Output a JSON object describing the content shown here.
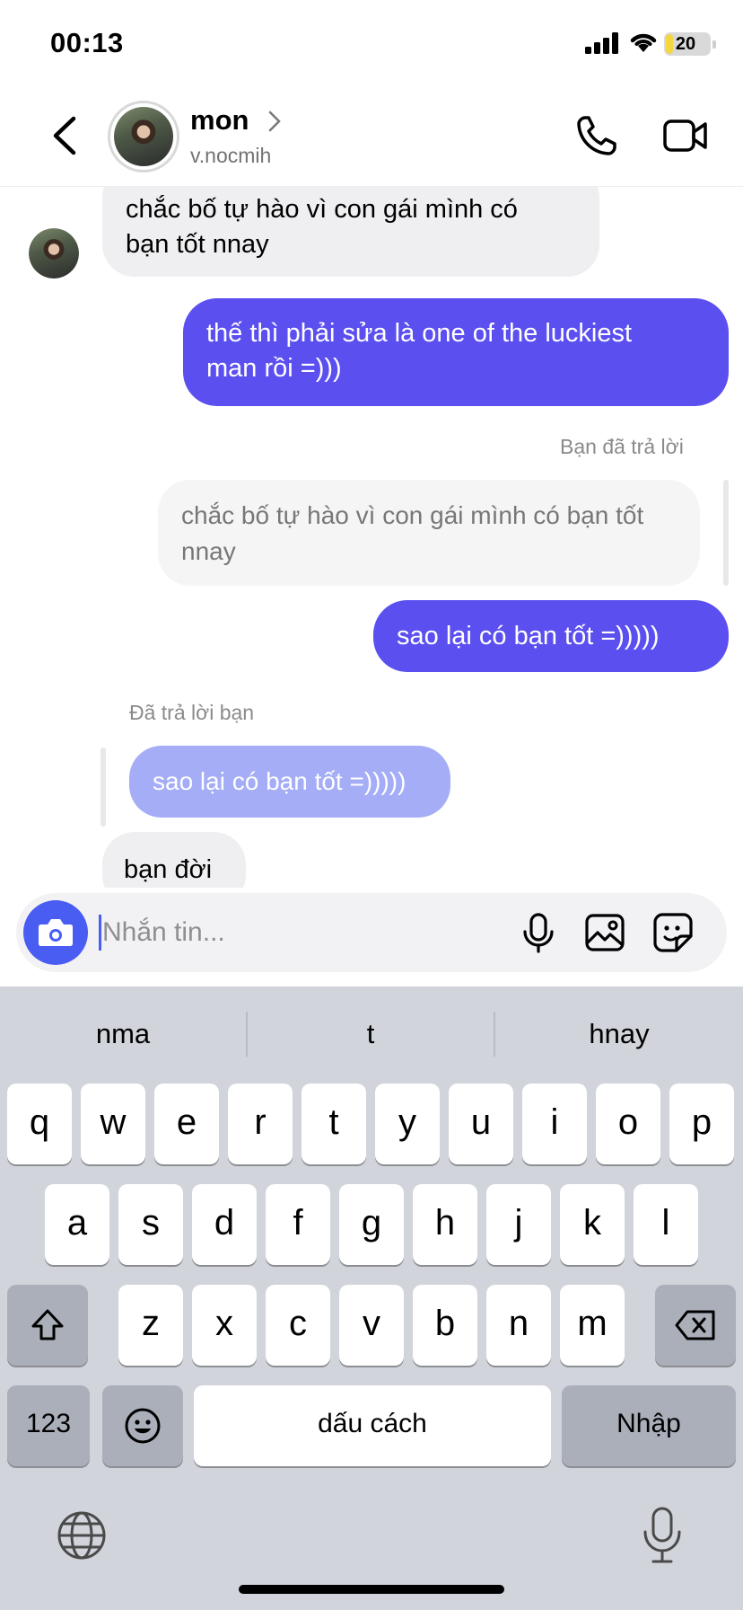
{
  "status_bar": {
    "time": "00:13",
    "battery": "20",
    "battery_level": 0.2
  },
  "header": {
    "contact_name": "mon",
    "username": "v.nocmih",
    "icons": [
      "back-arrow-icon",
      "chevron-right-icon",
      "phone-icon",
      "video-camera-icon"
    ]
  },
  "messages": {
    "msg1": {
      "lines": [
        "chắc bố tự hào vì con gái mình có",
        "bạn tốt nnay"
      ]
    },
    "msg2": {
      "lines": [
        "thế thì phải sửa là one of the luckiest",
        "man rồi =)))"
      ]
    },
    "reply1_label": "Bạn đã trả lời",
    "reply1_quote": {
      "lines": [
        "chắc bố tự hào vì con gái mình có bạn tốt",
        "nnay"
      ]
    },
    "msg3": "sao lại có bạn tốt =)))))",
    "reply2_label": "Đã trả lời bạn",
    "reply2_quote": "sao lại có bạn tốt =)))))",
    "msg4": "bạn đời"
  },
  "composer": {
    "placeholder": "Nhắn tin...",
    "value": ""
  },
  "keyboard": {
    "suggestions": [
      "nma",
      "t",
      "hnay"
    ],
    "row1": [
      "q",
      "w",
      "e",
      "r",
      "t",
      "y",
      "u",
      "i",
      "o",
      "p"
    ],
    "row2": [
      "a",
      "s",
      "d",
      "f",
      "g",
      "h",
      "j",
      "k",
      "l"
    ],
    "row3": [
      "z",
      "x",
      "c",
      "v",
      "b",
      "n",
      "m"
    ],
    "numbers_key": "123",
    "space_key": "dấu cách",
    "return_key": "Nhập"
  }
}
